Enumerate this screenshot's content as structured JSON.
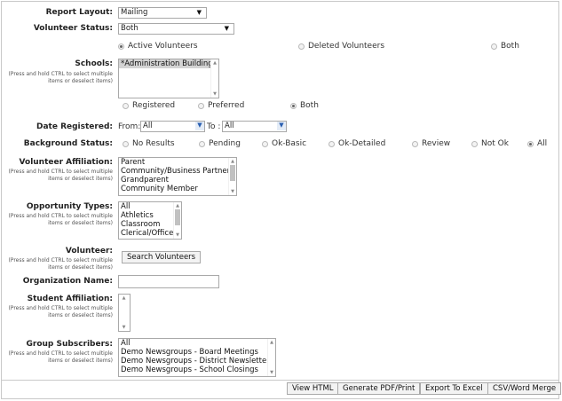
{
  "report_layout": {
    "label": "Report Layout:",
    "value": "Mailing"
  },
  "volunteer_status": {
    "label": "Volunteer Status:",
    "value": "Both",
    "options": [
      {
        "label": "Active Volunteers",
        "selected": true
      },
      {
        "label": "Deleted Volunteers",
        "selected": false
      },
      {
        "label": "Both",
        "selected": false
      }
    ]
  },
  "schools": {
    "label": "Schools:",
    "hint": "(Press and hold CTRL to select multiple items or deselect items)",
    "items": [
      "*Administration Building"
    ],
    "filter_options": [
      {
        "label": "Registered",
        "selected": false
      },
      {
        "label": "Preferred",
        "selected": false
      },
      {
        "label": "Both",
        "selected": true
      }
    ]
  },
  "date_registered": {
    "label": "Date Registered:",
    "from_label": "From:",
    "from_value": "All",
    "to_label": "To :",
    "to_value": "All"
  },
  "background_status": {
    "label": "Background Status:",
    "options": [
      {
        "label": "No Results",
        "selected": false
      },
      {
        "label": "Pending",
        "selected": false
      },
      {
        "label": "Ok-Basic",
        "selected": false
      },
      {
        "label": "Ok-Detailed",
        "selected": false
      },
      {
        "label": "Review",
        "selected": false
      },
      {
        "label": "Not Ok",
        "selected": false
      },
      {
        "label": "All",
        "selected": true
      }
    ]
  },
  "volunteer_affiliation": {
    "label": "Volunteer Affiliation:",
    "hint": "(Press and hold CTRL to select multiple items or deselect items)",
    "items": [
      "Parent",
      "Community/Business Partner",
      "Grandparent",
      "Community Member"
    ]
  },
  "opportunity_types": {
    "label": "Opportunity Types:",
    "hint": "(Press and hold CTRL to select multiple items or deselect items)",
    "items": [
      "All",
      "Athletics",
      "Classroom",
      "Clerical/Office"
    ]
  },
  "volunteer": {
    "label": "Volunteer:",
    "hint": "(Press and hold CTRL to select multiple items or deselect items)",
    "button": "Search Volunteers"
  },
  "organization_name": {
    "label": "Organization Name:",
    "value": ""
  },
  "student_affiliation": {
    "label": "Student Affiliation:",
    "hint": "(Press and hold CTRL to select multiple items or deselect items)"
  },
  "group_subscribers": {
    "label": "Group Subscribers:",
    "hint": "(Press and hold CTRL to select multiple items or deselect items)",
    "items": [
      "All",
      "Demo Newsgroups - Board Meetings",
      "Demo Newsgroups - District Newsletter",
      "Demo Newsgroups - School Closings"
    ]
  },
  "actions": {
    "view_html": "View HTML",
    "generate_pdf": "Generate PDF/Print",
    "export_excel": "Export To Excel",
    "csv_merge": "CSV/Word Merge"
  }
}
